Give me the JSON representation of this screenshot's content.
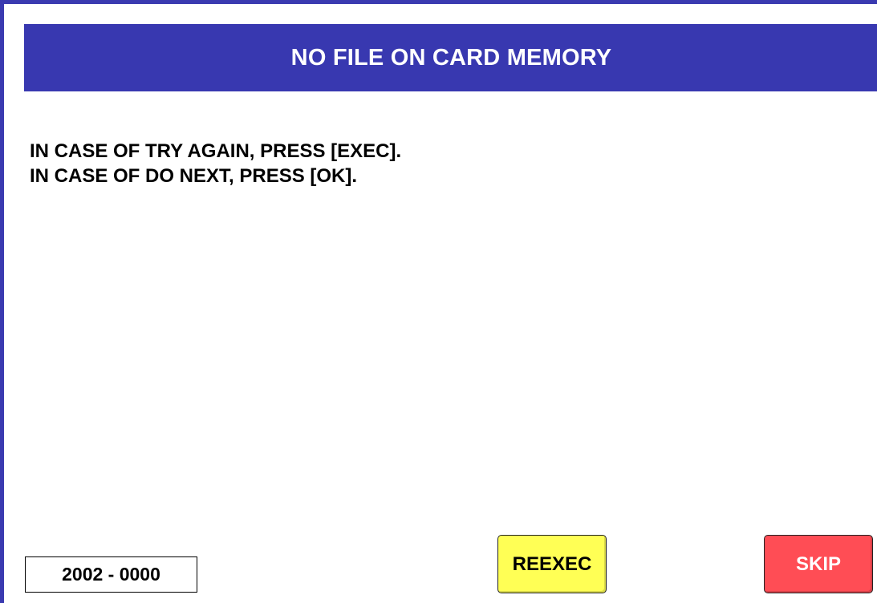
{
  "dialog": {
    "title": "NO FILE ON CARD MEMORY",
    "message_lines": [
      "IN CASE OF TRY AGAIN, PRESS [EXEC].",
      "IN CASE OF DO NEXT, PRESS [OK]."
    ],
    "error_code": "2002 - 0000"
  },
  "buttons": {
    "reexec_label": "REEXEC",
    "skip_label": "SKIP"
  },
  "colors": {
    "title_bar": "#3838b0",
    "reexec_button": "#ffff55",
    "skip_button": "#ff4d55",
    "frame_border": "#3a3ab0"
  }
}
